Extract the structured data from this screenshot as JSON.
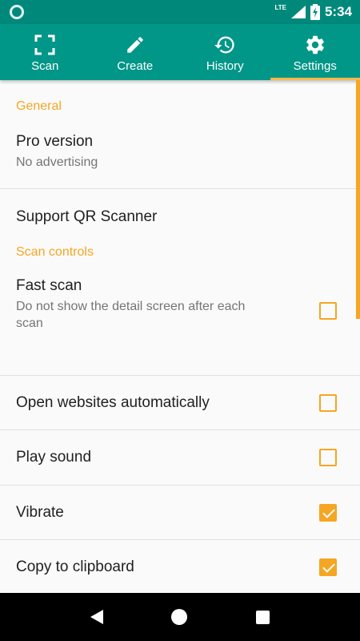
{
  "status": {
    "time": "5:34",
    "network": "LTE"
  },
  "tabs": [
    {
      "label": "Scan",
      "icon": "scan-frame-icon"
    },
    {
      "label": "Create",
      "icon": "pencil-icon"
    },
    {
      "label": "History",
      "icon": "history-icon"
    },
    {
      "label": "Settings",
      "icon": "gear-icon"
    }
  ],
  "active_tab": "Settings",
  "settings": {
    "general": {
      "header": "General",
      "pro_title": "Pro version",
      "pro_summary": "No advertising",
      "support_title": "Support QR Scanner"
    },
    "scan_controls": {
      "header": "Scan controls",
      "fast_scan_title": "Fast scan",
      "fast_scan_summary": "Do not show the detail screen after each scan",
      "fast_scan_checked": false,
      "open_websites_title": "Open websites automatically",
      "open_websites_checked": false,
      "play_sound_title": "Play sound",
      "play_sound_checked": false,
      "vibrate_title": "Vibrate",
      "vibrate_checked": true,
      "copy_clipboard_title": "Copy to clipboard",
      "copy_clipboard_checked": true
    }
  },
  "colors": {
    "primary": "#009688",
    "status_bar": "#00897b",
    "accent": "#f5a623"
  }
}
